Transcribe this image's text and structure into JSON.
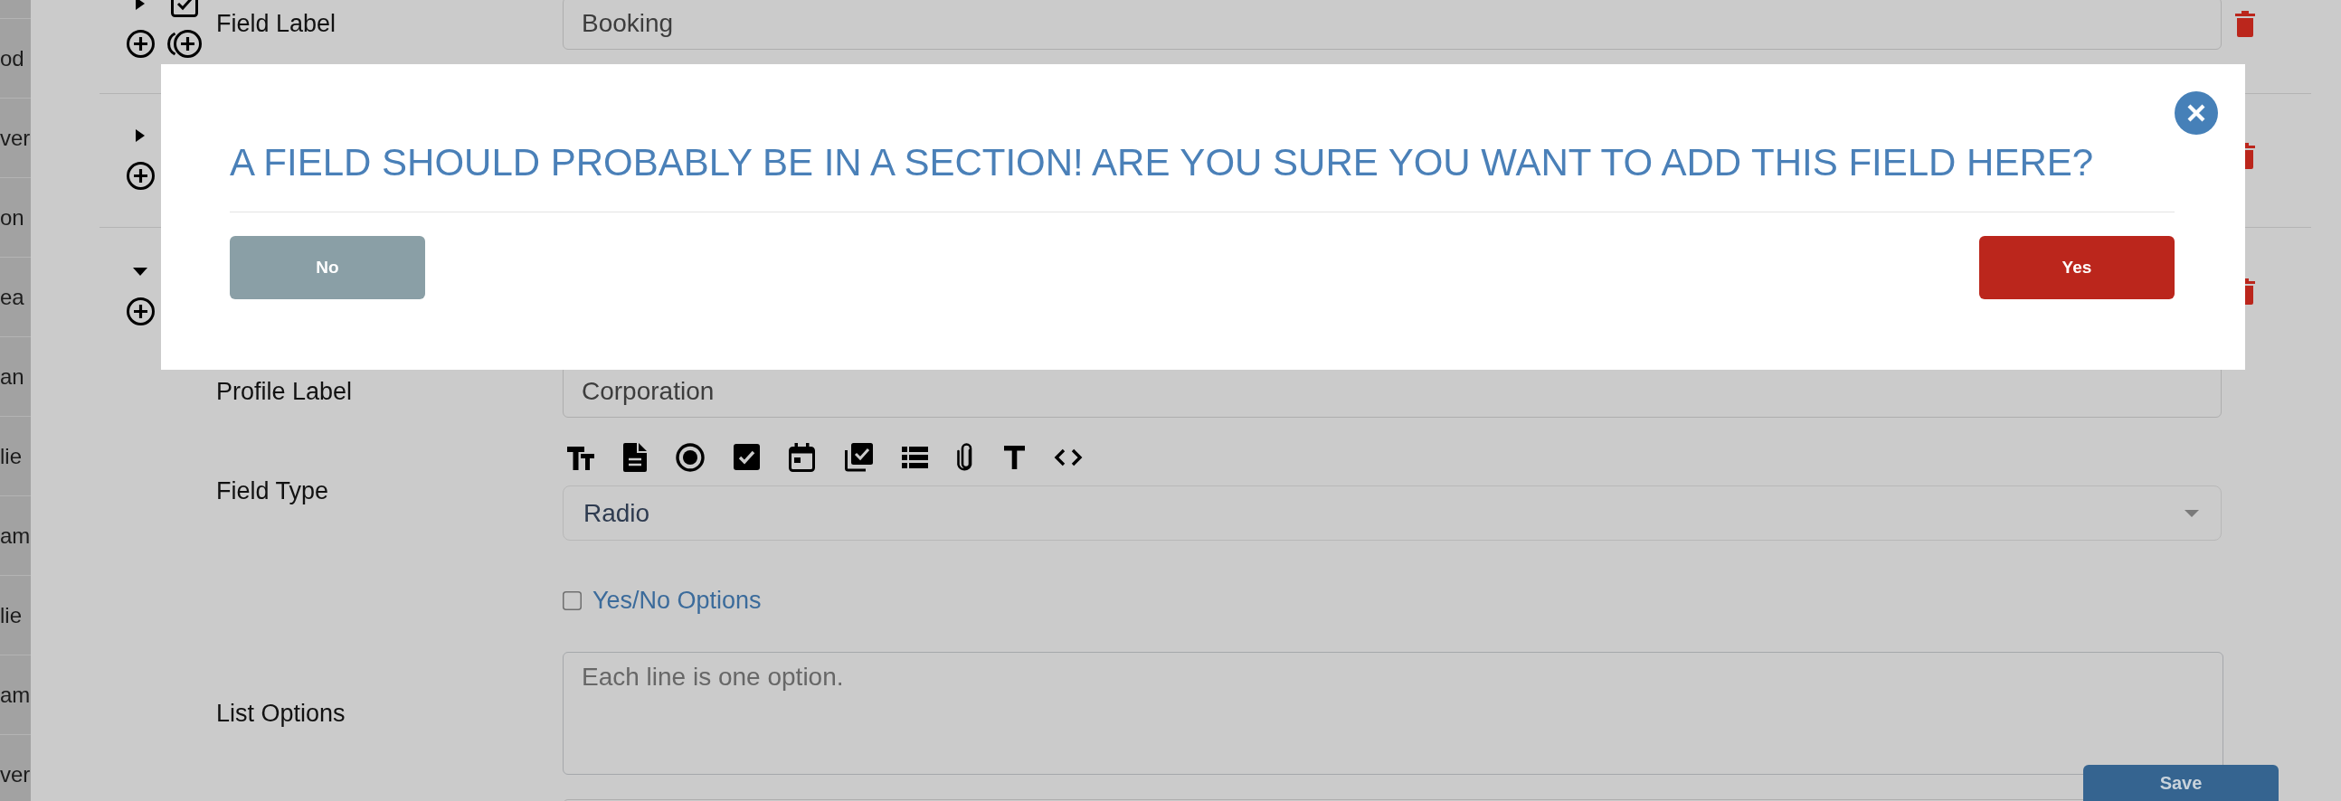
{
  "sidebar": {
    "items": [
      "od",
      "ver",
      "on",
      "ea",
      "an",
      "lie",
      "am",
      "lie",
      "am",
      "ver"
    ]
  },
  "tree": [
    {
      "kind": "field",
      "expanded": false,
      "fields": [
        {
          "kind": "text",
          "label": "Field Label",
          "value": "Booking"
        }
      ]
    },
    {
      "kind": "section",
      "expanded": false
    },
    {
      "kind": "section",
      "expanded": true,
      "fields": [
        {
          "kind": "text",
          "label": "Profile Label",
          "value": "Corporation"
        },
        {
          "kind": "select",
          "label": "Field Type",
          "value": "Radio"
        },
        {
          "kind": "checkbox",
          "label": "Yes/No Options",
          "checked": false
        },
        {
          "kind": "textarea",
          "label": "List Options",
          "placeholder": "Each line is one option."
        },
        {
          "kind": "text"
        }
      ]
    }
  ],
  "save_button": {
    "label": "Save"
  },
  "dialog": {
    "title": "A FIELD SHOULD PROBABLY BE IN A SECTION! ARE YOU SURE YOU WANT TO ADD THIS FIELD HERE?",
    "buttons": [
      {
        "kind": "cancel",
        "label": "No"
      },
      {
        "kind": "confirm",
        "label": "Yes"
      }
    ]
  }
}
